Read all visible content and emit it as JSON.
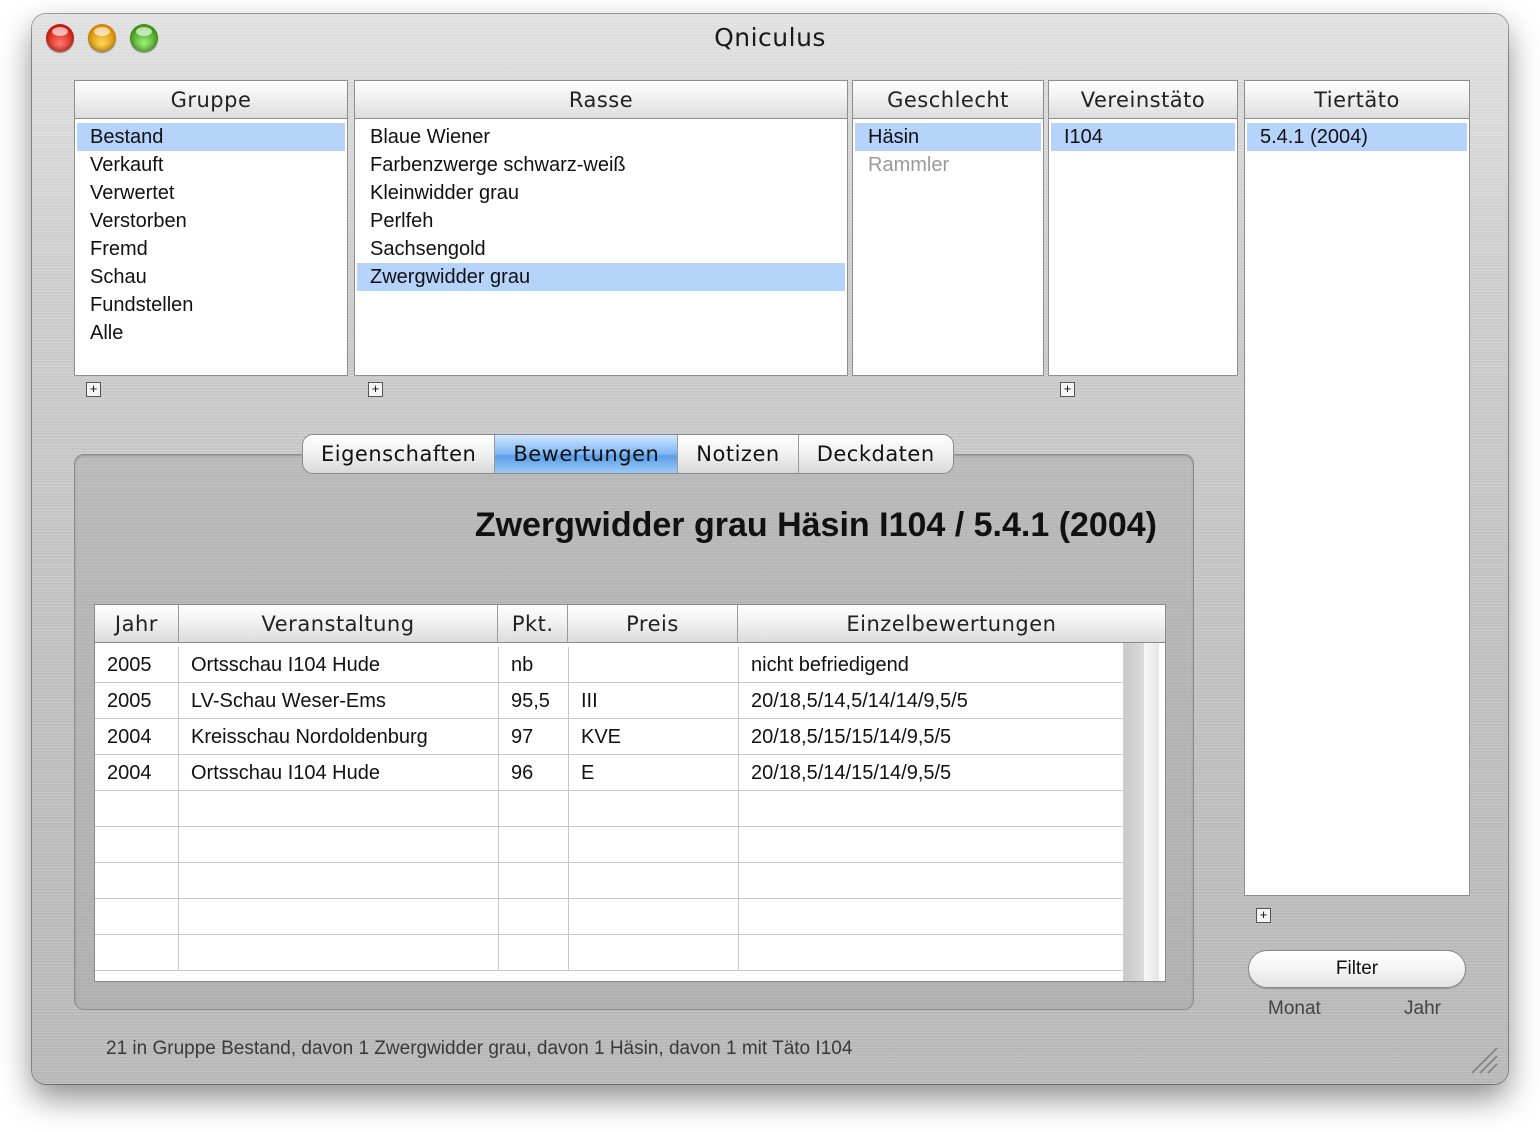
{
  "window": {
    "title": "Qniculus"
  },
  "columns": {
    "gruppe": {
      "header": "Gruppe",
      "items": [
        "Bestand",
        "Verkauft",
        "Verwertet",
        "Verstorben",
        "Fremd",
        "Schau",
        "Fundstellen",
        "Alle"
      ],
      "selected": 0
    },
    "rasse": {
      "header": "Rasse",
      "items": [
        "Blaue Wiener",
        "Farbenzwerge schwarz-weiß",
        "Kleinwidder grau",
        "Perlfeh",
        "Sachsengold",
        "Zwergwidder grau"
      ],
      "selected": 5
    },
    "geschlecht": {
      "header": "Geschlecht",
      "items": [
        "Häsin",
        "Rammler"
      ],
      "selected": 0
    },
    "vereinstato": {
      "header": "Vereinstäto",
      "items": [
        "I104"
      ],
      "selected": 0
    },
    "tiertato": {
      "header": "Tiertäto",
      "items": [
        "5.4.1 (2004)"
      ],
      "selected": 0
    }
  },
  "tabs": [
    "Eigenschaften",
    "Bewertungen",
    "Notizen",
    "Deckdaten"
  ],
  "active_tab": "Bewertungen",
  "detail": {
    "title": "Zwergwidder grau Häsin I104 / 5.4.1 (2004)",
    "table": {
      "headers": [
        "Jahr",
        "Veranstaltung",
        "Pkt.",
        "Preis",
        "Einzelbewertungen"
      ],
      "rows": [
        [
          "2005",
          "Ortsschau I104 Hude",
          "nb",
          "",
          "nicht befriedigend"
        ],
        [
          "2005",
          "LV-Schau Weser-Ems",
          "95,5",
          "III",
          "20/18,5/14,5/14/14/9,5/5"
        ],
        [
          "2004",
          "Kreisschau Nordoldenburg",
          "97",
          "KVE",
          "20/18,5/15/15/14/9,5/5"
        ],
        [
          "2004",
          "Ortsschau I104 Hude",
          "96",
          "E",
          "20/18,5/14/15/14/9,5/5"
        ]
      ]
    }
  },
  "filter": {
    "button_label": "Filter",
    "monat_label": "Monat",
    "jahr_label": "Jahr"
  },
  "plus_label": "+",
  "status_text": "21 in Gruppe Bestand, davon 1 Zwergwidder grau, davon 1 Häsin, davon 1 mit Täto I104",
  "colors": {
    "selection": "#b5d3fb",
    "active_tab": "#5a9ee8"
  }
}
